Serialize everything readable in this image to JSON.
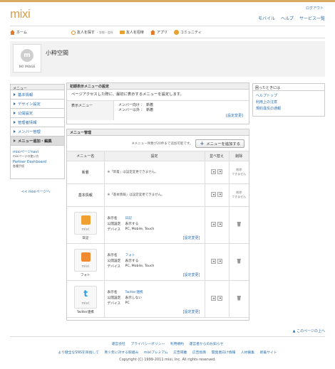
{
  "header": {
    "logo": "mixi",
    "logout": "ログアウト",
    "links": [
      "モバイル",
      "ヘルプ",
      "サービス一覧"
    ]
  },
  "nav": {
    "home": "ホーム",
    "search": "友人を探す",
    "search_sub": "・学校・会社",
    "invite": "友人を招待",
    "app": "アプリ",
    "community": "コミュニティ"
  },
  "profile": {
    "noimage": "NO IMAGE",
    "name": "小粋空間"
  },
  "sidebar": {
    "title": "メニュー",
    "items": [
      "基本情報",
      "デザイン設定",
      "公開設定",
      "管理者情報",
      "メンバー管理",
      "メニュー追加・編集"
    ],
    "mixi_pages_link": "mixiページnavi",
    "mixi_pages_sub": "mixiページの使い方",
    "partner_link": "Partner Dashboard",
    "partner_sub": "各種手続",
    "back": "<< mixiページへ"
  },
  "help_box": {
    "title": "困ったときには",
    "links": [
      "ヘルプトップ",
      "利用上の注意",
      "規約違反の通報"
    ]
  },
  "initial_menu": {
    "title": "初期表示メニューの設定",
    "desc": "ページアクセスした際に、最初に表示するメニューを設定します。",
    "label": "表示メニュー",
    "values": [
      "メンバー向け ：　新着",
      "メンバー以外 ：　新着"
    ],
    "edit": "[設定変更]"
  },
  "menu_manage": {
    "title": "メニュー管理",
    "note": "※メニュー件数が20件まで追加可能です。",
    "add_button": "メニューを追加する",
    "headers": [
      "メニュー名",
      "設定",
      "並べ替え",
      "削除"
    ],
    "rows": [
      {
        "name": "新着",
        "setting": "※「新着」は設定変更できません。",
        "delete": "削除\nできません"
      },
      {
        "name": "基本情報",
        "setting": "※「基本情報」は設定変更できません。",
        "delete": "削除\nできません"
      }
    ],
    "apps": [
      {
        "caption": "日記",
        "k1": "表示名",
        "title": "日記",
        "k2": "公開設定",
        "visibility": "表示する",
        "k3": "デバイス",
        "device": "PC, Mobile, Touch",
        "edit": "[設定変更]"
      },
      {
        "caption": "フォト",
        "k1": "表示名",
        "title": "フォト",
        "k2": "公開設定",
        "visibility": "表示する",
        "k3": "デバイス",
        "device": "PC, Mobile, Touch",
        "edit": "[設定変更]"
      },
      {
        "caption": "Twitter連携",
        "k1": "表示名",
        "title": "Twitter連携",
        "k2": "公開設定",
        "visibility": "表示しない",
        "k3": "デバイス",
        "device": "PC",
        "edit": "[設定変更]"
      }
    ],
    "icon_label": "mixi"
  },
  "footer": {
    "pagetop": "▲ このページの上へ",
    "row1": [
      "運営会社",
      "プライバシーポリシー",
      "利用規約",
      "運営者からのお知らせ"
    ],
    "row2": [
      "より健全なSNSを目指して",
      "青少年に対する取組み",
      "mixiプレミアム",
      "広告掲載",
      "広告指南",
      "開発者向け情報",
      "人材募集",
      "新着サイト"
    ],
    "copyright": "Copyright (C) 1999-2011 mixi, Inc. All rights reserved."
  },
  "colors": {
    "accent": "#d4a050",
    "link": "#2a6fb0"
  }
}
